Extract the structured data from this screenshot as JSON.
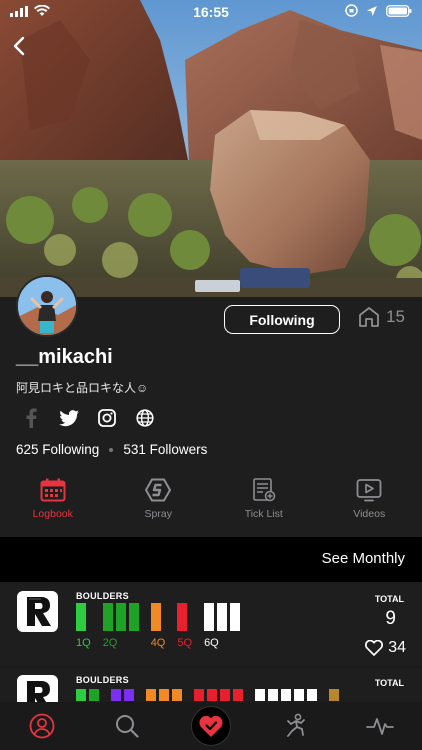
{
  "status_bar": {
    "time": "16:55"
  },
  "profile": {
    "follow_button": "Following",
    "ascent_count": "15",
    "username": "__mikachi",
    "bio": "阿見ロキと品ロキな人☺",
    "following_text": "625 Following",
    "followers_text": "531 Followers"
  },
  "tabs": [
    {
      "label": "Logbook",
      "icon": "calendar-icon",
      "active": true
    },
    {
      "label": "Spray",
      "icon": "spray-icon",
      "active": false
    },
    {
      "label": "Tick List",
      "icon": "tick-list-icon",
      "active": false
    },
    {
      "label": "Videos",
      "icon": "video-icon",
      "active": false
    }
  ],
  "see_monthly": "See Monthly",
  "logbook": [
    {
      "category": "BOULDERS",
      "total_label": "TOTAL",
      "total": "9",
      "likes": "34",
      "grades": [
        {
          "label": "1Q",
          "count": 1,
          "color": "#2ecc40"
        },
        {
          "label": "2Q",
          "count": 3,
          "color": "#1fa327"
        },
        {
          "label": "4Q",
          "count": 1,
          "color": "#f08a24"
        },
        {
          "label": "5Q",
          "count": 1,
          "color": "#e8202e"
        },
        {
          "label": "6Q",
          "count": 3,
          "color": "#ffffff"
        }
      ]
    },
    {
      "category": "BOULDERS",
      "total_label": "TOTAL"
    }
  ],
  "colors": {
    "accent": "#e8343f",
    "muted": "#8e8e93"
  }
}
